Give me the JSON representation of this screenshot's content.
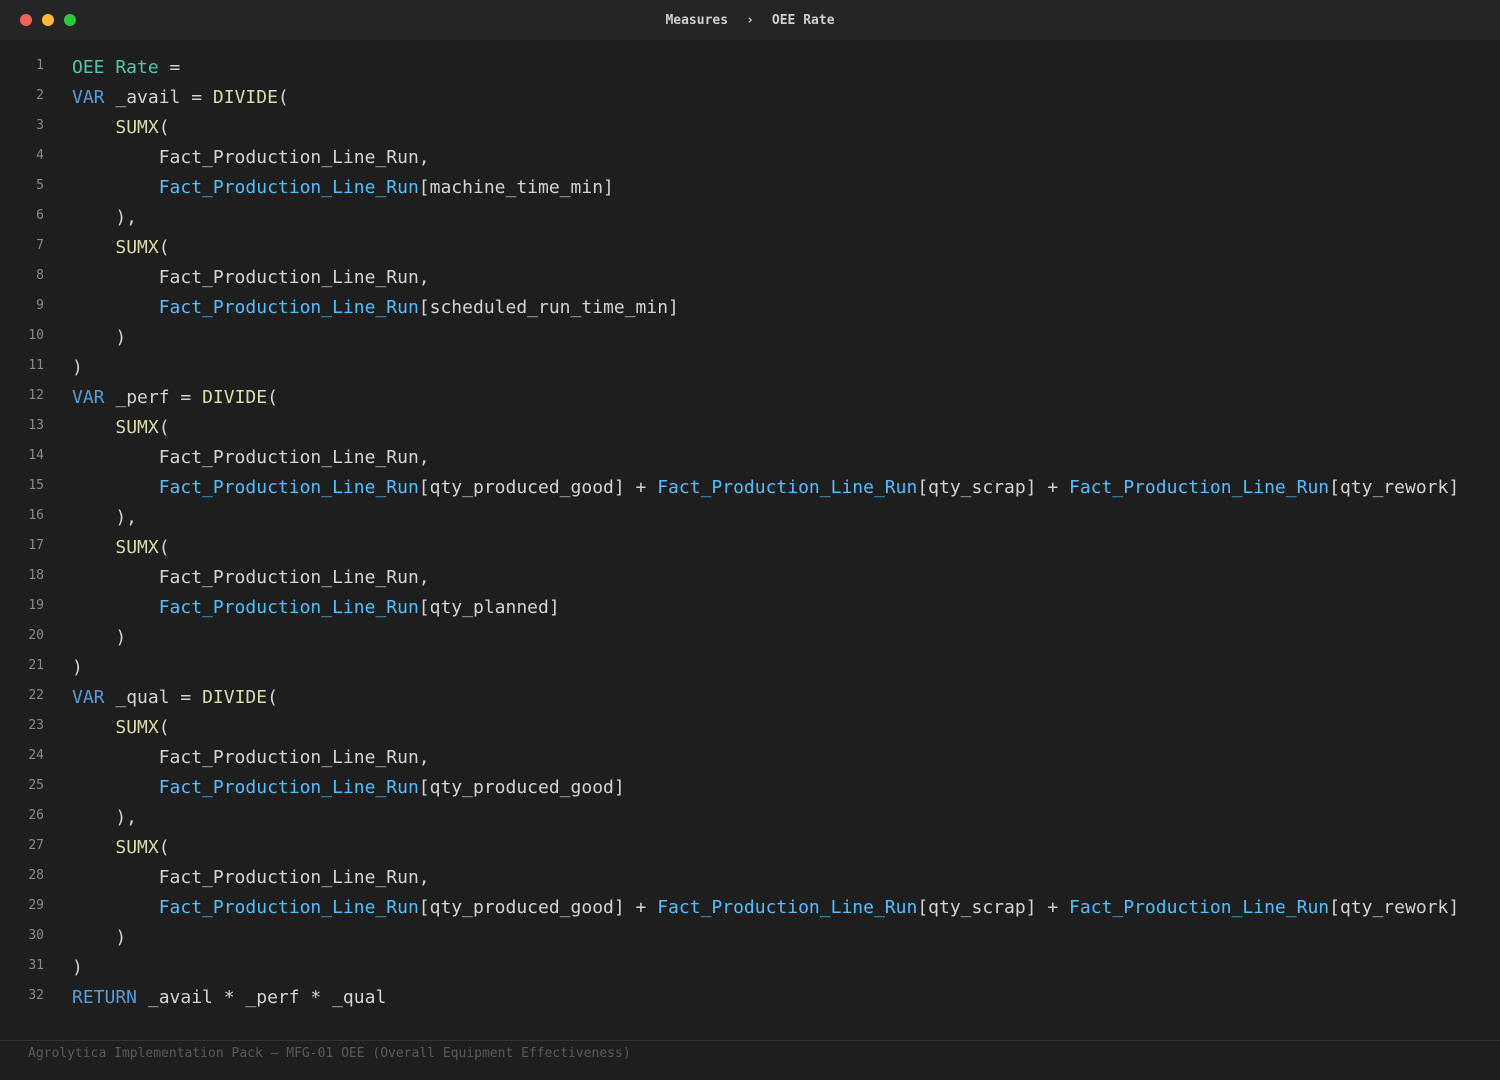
{
  "window": {
    "breadcrumb": [
      "Measures",
      "OEE Rate"
    ],
    "separator": "›",
    "controls": {
      "close_color": "#ff5f57",
      "minimize_color": "#febc2e",
      "maximize_color": "#28c840"
    }
  },
  "editor": {
    "lines": [
      {
        "n": "1",
        "tokens": [
          {
            "t": "OEE Rate",
            "k": "measure"
          },
          {
            "t": " =",
            "k": "plain"
          }
        ]
      },
      {
        "n": "2",
        "tokens": [
          {
            "t": "VAR",
            "k": "kw"
          },
          {
            "t": " _avail = ",
            "k": "plain"
          },
          {
            "t": "DIVIDE",
            "k": "fn"
          },
          {
            "t": "(",
            "k": "plain"
          }
        ]
      },
      {
        "n": "3",
        "tokens": [
          {
            "t": "    ",
            "k": "plain"
          },
          {
            "t": "SUMX",
            "k": "fn"
          },
          {
            "t": "(",
            "k": "plain"
          }
        ]
      },
      {
        "n": "4",
        "tokens": [
          {
            "t": "        Fact_Production_Line_Run,",
            "k": "tbl"
          }
        ]
      },
      {
        "n": "5",
        "tokens": [
          {
            "t": "        ",
            "k": "plain"
          },
          {
            "t": "Fact_Production_Line_Run",
            "k": "coltbl"
          },
          {
            "t": "[machine_time_min]",
            "k": "plain"
          }
        ]
      },
      {
        "n": "6",
        "tokens": [
          {
            "t": "    ),",
            "k": "plain"
          }
        ]
      },
      {
        "n": "7",
        "tokens": [
          {
            "t": "    ",
            "k": "plain"
          },
          {
            "t": "SUMX",
            "k": "fn"
          },
          {
            "t": "(",
            "k": "plain"
          }
        ]
      },
      {
        "n": "8",
        "tokens": [
          {
            "t": "        Fact_Production_Line_Run,",
            "k": "tbl"
          }
        ]
      },
      {
        "n": "9",
        "tokens": [
          {
            "t": "        ",
            "k": "plain"
          },
          {
            "t": "Fact_Production_Line_Run",
            "k": "coltbl"
          },
          {
            "t": "[scheduled_run_time_min]",
            "k": "plain"
          }
        ]
      },
      {
        "n": "10",
        "tokens": [
          {
            "t": "    )",
            "k": "plain"
          }
        ]
      },
      {
        "n": "11",
        "tokens": [
          {
            "t": ")",
            "k": "plain"
          }
        ]
      },
      {
        "n": "12",
        "tokens": [
          {
            "t": "VAR",
            "k": "kw"
          },
          {
            "t": " _perf = ",
            "k": "plain"
          },
          {
            "t": "DIVIDE",
            "k": "fn"
          },
          {
            "t": "(",
            "k": "plain"
          }
        ]
      },
      {
        "n": "13",
        "tokens": [
          {
            "t": "    ",
            "k": "plain"
          },
          {
            "t": "SUMX",
            "k": "fn"
          },
          {
            "t": "(",
            "k": "plain"
          }
        ]
      },
      {
        "n": "14",
        "tokens": [
          {
            "t": "        Fact_Production_Line_Run,",
            "k": "tbl"
          }
        ]
      },
      {
        "n": "15",
        "tokens": [
          {
            "t": "        ",
            "k": "plain"
          },
          {
            "t": "Fact_Production_Line_Run",
            "k": "coltbl"
          },
          {
            "t": "[qty_produced_good] + ",
            "k": "plain"
          },
          {
            "t": "Fact_Production_Line_Run",
            "k": "coltbl"
          },
          {
            "t": "[qty_scrap] + ",
            "k": "plain"
          },
          {
            "t": "Fact_Production_Line_Run",
            "k": "coltbl"
          },
          {
            "t": "[qty_rework]",
            "k": "plain"
          }
        ]
      },
      {
        "n": "16",
        "tokens": [
          {
            "t": "    ),",
            "k": "plain"
          }
        ]
      },
      {
        "n": "17",
        "tokens": [
          {
            "t": "    ",
            "k": "plain"
          },
          {
            "t": "SUMX",
            "k": "fn"
          },
          {
            "t": "(",
            "k": "plain"
          }
        ]
      },
      {
        "n": "18",
        "tokens": [
          {
            "t": "        Fact_Production_Line_Run,",
            "k": "tbl"
          }
        ]
      },
      {
        "n": "19",
        "tokens": [
          {
            "t": "        ",
            "k": "plain"
          },
          {
            "t": "Fact_Production_Line_Run",
            "k": "coltbl"
          },
          {
            "t": "[qty_planned]",
            "k": "plain"
          }
        ]
      },
      {
        "n": "20",
        "tokens": [
          {
            "t": "    )",
            "k": "plain"
          }
        ]
      },
      {
        "n": "21",
        "tokens": [
          {
            "t": ")",
            "k": "plain"
          }
        ]
      },
      {
        "n": "22",
        "tokens": [
          {
            "t": "VAR",
            "k": "kw"
          },
          {
            "t": " _qual = ",
            "k": "plain"
          },
          {
            "t": "DIVIDE",
            "k": "fn"
          },
          {
            "t": "(",
            "k": "plain"
          }
        ]
      },
      {
        "n": "23",
        "tokens": [
          {
            "t": "    ",
            "k": "plain"
          },
          {
            "t": "SUMX",
            "k": "fn"
          },
          {
            "t": "(",
            "k": "plain"
          }
        ]
      },
      {
        "n": "24",
        "tokens": [
          {
            "t": "        Fact_Production_Line_Run,",
            "k": "tbl"
          }
        ]
      },
      {
        "n": "25",
        "tokens": [
          {
            "t": "        ",
            "k": "plain"
          },
          {
            "t": "Fact_Production_Line_Run",
            "k": "coltbl"
          },
          {
            "t": "[qty_produced_good]",
            "k": "plain"
          }
        ]
      },
      {
        "n": "26",
        "tokens": [
          {
            "t": "    ),",
            "k": "plain"
          }
        ]
      },
      {
        "n": "27",
        "tokens": [
          {
            "t": "    ",
            "k": "plain"
          },
          {
            "t": "SUMX",
            "k": "fn"
          },
          {
            "t": "(",
            "k": "plain"
          }
        ]
      },
      {
        "n": "28",
        "tokens": [
          {
            "t": "        Fact_Production_Line_Run,",
            "k": "tbl"
          }
        ]
      },
      {
        "n": "29",
        "tokens": [
          {
            "t": "        ",
            "k": "plain"
          },
          {
            "t": "Fact_Production_Line_Run",
            "k": "coltbl"
          },
          {
            "t": "[qty_produced_good] + ",
            "k": "plain"
          },
          {
            "t": "Fact_Production_Line_Run",
            "k": "coltbl"
          },
          {
            "t": "[qty_scrap] + ",
            "k": "plain"
          },
          {
            "t": "Fact_Production_Line_Run",
            "k": "coltbl"
          },
          {
            "t": "[qty_rework]",
            "k": "plain"
          }
        ]
      },
      {
        "n": "30",
        "tokens": [
          {
            "t": "    )",
            "k": "plain"
          }
        ]
      },
      {
        "n": "31",
        "tokens": [
          {
            "t": ")",
            "k": "plain"
          }
        ]
      },
      {
        "n": "32",
        "tokens": [
          {
            "t": "RETURN",
            "k": "kw"
          },
          {
            "t": " _avail * _perf * _qual",
            "k": "plain"
          }
        ]
      }
    ]
  },
  "footer": {
    "text": "Agrolytica Implementation Pack — MFG-01 OEE (Overall Equipment Effectiveness)"
  }
}
